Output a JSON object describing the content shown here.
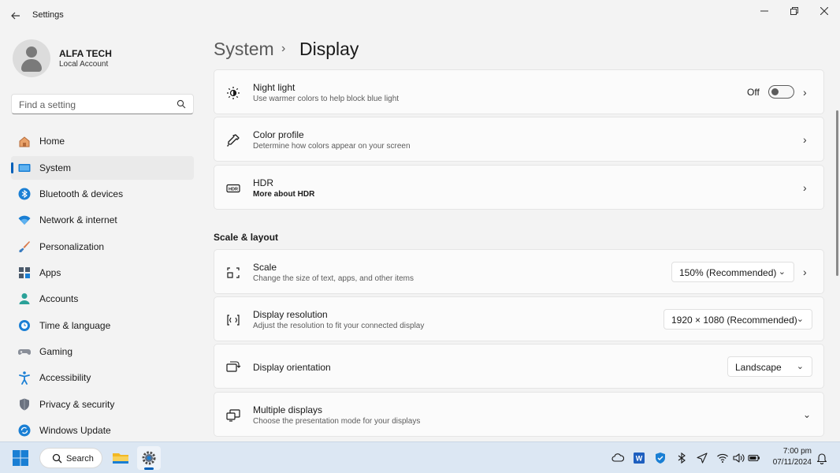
{
  "window": {
    "title": "Settings",
    "back_icon": "back-arrow-icon",
    "controls": [
      "minimize-icon",
      "restore-icon",
      "close-icon"
    ]
  },
  "user": {
    "name": "ALFA TECH",
    "account_type": "Local Account"
  },
  "search": {
    "placeholder": "Find a setting"
  },
  "sidebar": {
    "items": [
      {
        "label": "Home",
        "icon": "home-icon",
        "active": false
      },
      {
        "label": "System",
        "icon": "system-display-icon",
        "active": true
      },
      {
        "label": "Bluetooth & devices",
        "icon": "bluetooth-icon",
        "active": false
      },
      {
        "label": "Network & internet",
        "icon": "wifi-icon",
        "active": false
      },
      {
        "label": "Personalization",
        "icon": "brush-icon",
        "active": false
      },
      {
        "label": "Apps",
        "icon": "apps-icon",
        "active": false
      },
      {
        "label": "Accounts",
        "icon": "accounts-icon",
        "active": false
      },
      {
        "label": "Time & language",
        "icon": "globe-clock-icon",
        "active": false
      },
      {
        "label": "Gaming",
        "icon": "gamepad-icon",
        "active": false
      },
      {
        "label": "Accessibility",
        "icon": "accessibility-icon",
        "active": false
      },
      {
        "label": "Privacy & security",
        "icon": "shield-icon",
        "active": false
      },
      {
        "label": "Windows Update",
        "icon": "windows-update-icon",
        "active": false
      }
    ]
  },
  "breadcrumb": {
    "parent": "System",
    "separator": "›",
    "current": "Display"
  },
  "cards": {
    "night_light": {
      "title": "Night light",
      "subtitle": "Use warmer colors to help block blue light",
      "state": "Off",
      "icon": "brightness-icon"
    },
    "color_profile": {
      "title": "Color profile",
      "subtitle": "Determine how colors appear on your screen",
      "icon": "eyedropper-icon"
    },
    "hdr": {
      "title": "HDR",
      "subtitle": "More about HDR",
      "icon": "hdr-icon"
    },
    "section": "Scale & layout",
    "scale": {
      "title": "Scale",
      "subtitle": "Change the size of text, apps, and other items",
      "value": "150% (Recommended)",
      "icon": "scale-icon"
    },
    "resolution": {
      "title": "Display resolution",
      "subtitle": "Adjust the resolution to fit your connected display",
      "value": "1920 × 1080 (Recommended)",
      "icon": "resolution-icon"
    },
    "orientation": {
      "title": "Display orientation",
      "value": "Landscape",
      "icon": "orientation-icon"
    },
    "multiple": {
      "title": "Multiple displays",
      "subtitle": "Choose the presentation mode for your displays",
      "icon": "multiple-displays-icon"
    }
  },
  "taskbar": {
    "search_label": "Search",
    "apps": [
      "windows-start-icon",
      "file-explorer-icon",
      "settings-gear-icon"
    ],
    "tray": [
      "onedrive-cloud-icon",
      "word-icon",
      "defender-shield-icon",
      "bluetooth-icon",
      "location-icon",
      "wifi-icon",
      "volume-icon",
      "battery-icon",
      "notification-bell-icon"
    ],
    "time": "7:00 pm",
    "date": "07/11/2024"
  },
  "colors": {
    "accent": "#005fb8",
    "background": "#f3f3f3",
    "card": "#fbfbfb",
    "taskbar": "#dce7f3"
  }
}
